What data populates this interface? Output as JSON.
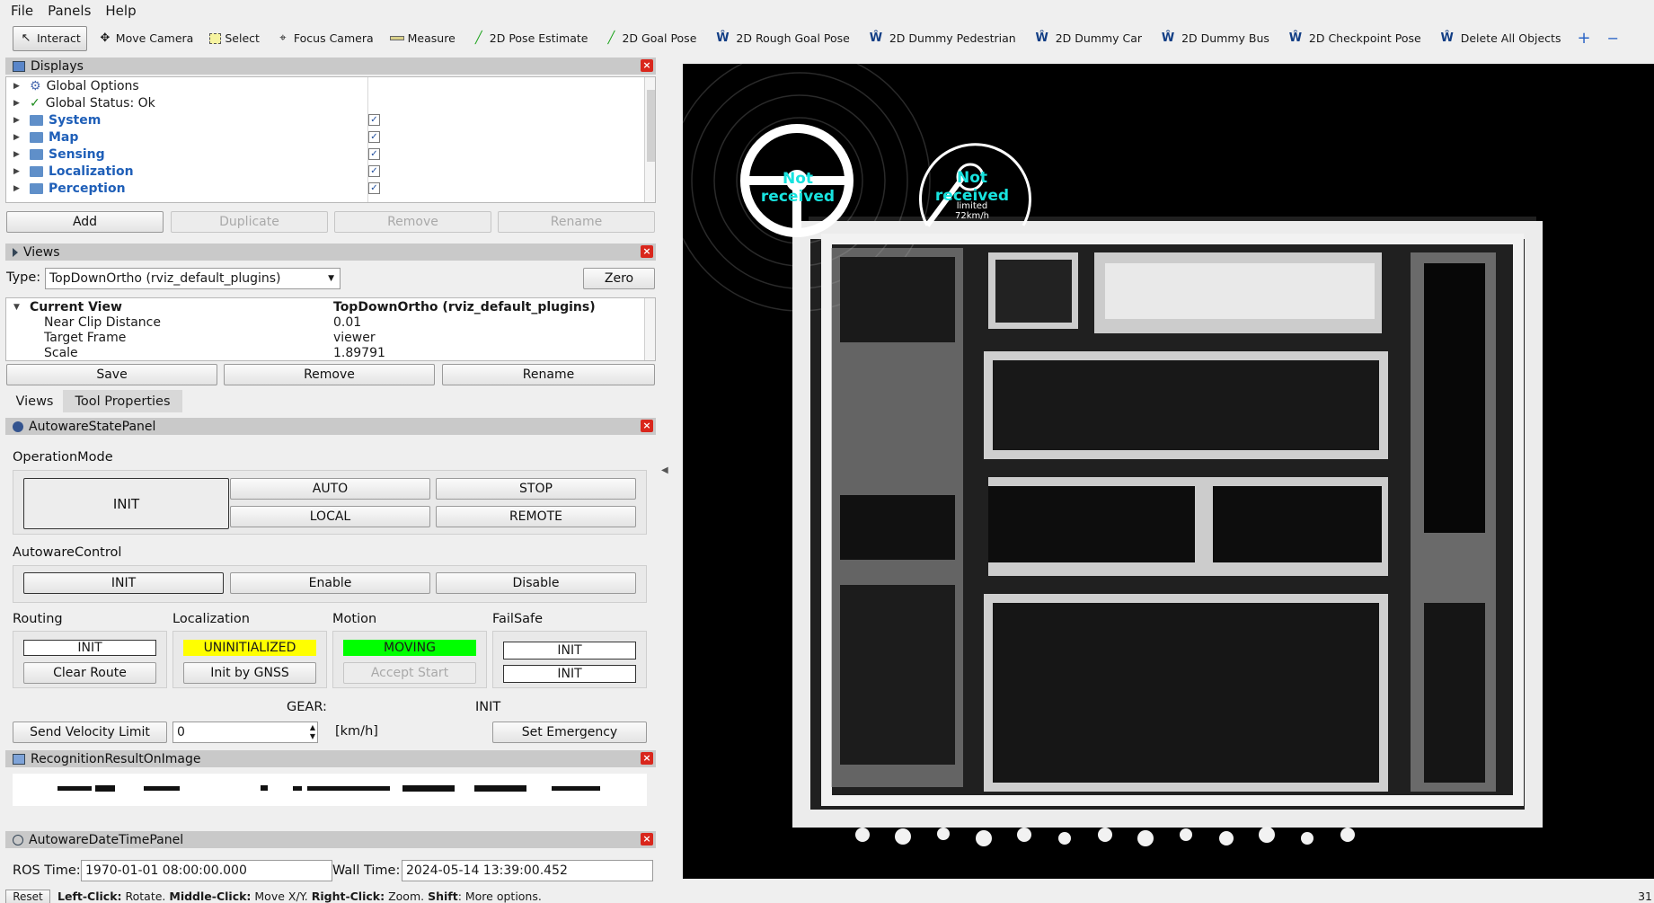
{
  "menu": {
    "file": "File",
    "panels": "Panels",
    "help": "Help"
  },
  "toolbar": {
    "tools": [
      {
        "label": "Interact",
        "icon": "cursor-icon"
      },
      {
        "label": "Move Camera",
        "icon": "move-camera-icon"
      },
      {
        "label": "Select",
        "icon": "select-icon"
      },
      {
        "label": "Focus Camera",
        "icon": "focus-camera-icon"
      },
      {
        "label": "Measure",
        "icon": "ruler-icon"
      },
      {
        "label": "2D Pose Estimate",
        "icon": "green-arrow-icon"
      },
      {
        "label": "2D Goal Pose",
        "icon": "green-arrow-icon"
      },
      {
        "label": "2D Rough Goal Pose",
        "icon": "autoware-icon"
      },
      {
        "label": "2D Dummy Pedestrian",
        "icon": "autoware-icon"
      },
      {
        "label": "2D Dummy Car",
        "icon": "autoware-icon"
      },
      {
        "label": "2D Dummy Bus",
        "icon": "autoware-icon"
      },
      {
        "label": "2D Checkpoint Pose",
        "icon": "autoware-icon"
      },
      {
        "label": "Delete All Objects",
        "icon": "autoware-icon"
      }
    ],
    "plus": "+",
    "minus": "−"
  },
  "displays": {
    "title": "Displays",
    "items": [
      {
        "label": "Global Options",
        "checked": false
      },
      {
        "label": "Global Status: Ok",
        "checked": false
      },
      {
        "label": "System",
        "checked": true
      },
      {
        "label": "Map",
        "checked": true
      },
      {
        "label": "Sensing",
        "checked": true
      },
      {
        "label": "Localization",
        "checked": true
      },
      {
        "label": "Perception",
        "checked": true
      }
    ],
    "buttons": {
      "add": "Add",
      "duplicate": "Duplicate",
      "remove": "Remove",
      "rename": "Rename"
    }
  },
  "views": {
    "title": "Views",
    "type_label": "Type:",
    "type_value": "TopDownOrtho (rviz_default_plugins)",
    "zero": "Zero",
    "current_view": "Current View",
    "current_value": "TopDownOrtho (rviz_default_plugins)",
    "props": [
      {
        "k": "Near Clip Distance",
        "v": "0.01"
      },
      {
        "k": "Target Frame",
        "v": "viewer"
      },
      {
        "k": "Scale",
        "v": "1.89791"
      }
    ],
    "save": "Save",
    "remove": "Remove",
    "rename": "Rename",
    "tab_views": "Views",
    "tab_tool": "Tool Properties"
  },
  "state": {
    "title": "AutowareStatePanel",
    "opmode": "OperationMode",
    "init": "INIT",
    "auto": "AUTO",
    "stop": "STOP",
    "local": "LOCAL",
    "remote": "REMOTE",
    "control": "AutowareControl",
    "enable": "Enable",
    "disable": "Disable",
    "routing": "Routing",
    "localization": "Localization",
    "motion": "Motion",
    "failsafe": "FailSafe",
    "routing_state": "INIT",
    "clear_route": "Clear Route",
    "loc_state": "UNINITIALIZED",
    "init_gnss": "Init by GNSS",
    "motion_state": "MOVING",
    "accept_start": "Accept Start",
    "fs1": "INIT",
    "fs2": "INIT",
    "gear_label": "GEAR:",
    "gear_value": "INIT",
    "send_velocity": "Send Velocity Limit",
    "velocity": "0",
    "unit": "[km/h]",
    "set_emergency": "Set Emergency",
    "colors": {
      "uninit": "#ffff00",
      "moving": "#00ff00"
    }
  },
  "recog": {
    "title": "RecognitionResultOnImage"
  },
  "datetime": {
    "title": "AutowareDateTimePanel",
    "ros_label": "ROS Time:",
    "ros_value": "1970-01-01 08:00:00.000",
    "wall_label": "Wall Time:",
    "wall_value": "2024-05-14 13:39:00.452"
  },
  "viz": {
    "steer_text": "Not received",
    "speed_text": "Not received",
    "limit_label": "limited",
    "limit_value": "72km/h"
  },
  "status": {
    "reset": "Reset",
    "b1": "Left-Click:",
    "t1": " Rotate. ",
    "b2": "Middle-Click:",
    "t2": " Move X/Y. ",
    "b3": "Right-Click:",
    "t3": " Zoom. ",
    "b4": "Shift",
    "t4": ": More options.",
    "fps": "31"
  }
}
